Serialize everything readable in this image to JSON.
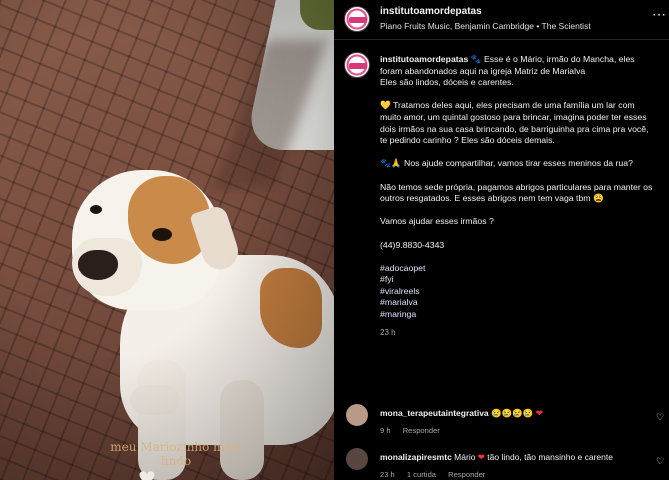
{
  "photo": {
    "caption_line1": "meu Mariozinho mais",
    "caption_line2": "lindo",
    "sticker_icon": "heart-sticker-icon"
  },
  "header": {
    "username": "institutoamordepatas",
    "audio": "Piano Fruits Music, Benjamin Cambridge • The Scientist",
    "more_icon": "more-dots-icon"
  },
  "caption": {
    "username": "institutoamordepatas",
    "line_intro": " 🐾 Esse é o Mário, irmão do Mancha, eles foram abandonados aqui na igreja Matriz de Marialva",
    "line_intro2": "Eles são lindos, dóceis e carentes.",
    "para2": "💛 Tratamos deles aqui, eles precisam de uma família um lar com muito amor, um quintal gostoso para brincar, imagina poder ter esses dois irmãos na sua casa brincando, de barriguinha pra cima pra você, te pedindo carinho ? Eles são dóceis demais.",
    "para3": "🐾🙏 Nos ajude compartilhar, vamos tirar esses meninos da rua?",
    "para4": "Não temos sede própria, pagamos abrigos particulares para manter os outros resgatados. E esses abrigos nem tem vaga tbm 😩",
    "para5": "Vamos ajudar esses irmãos ?",
    "phone": "(44)9.8830-4343",
    "hashtags": [
      "#adocaopet",
      "#fyi",
      "#viralreels",
      "#marialva",
      "#maringa"
    ],
    "time": "23 h"
  },
  "comments": [
    {
      "username": "mona_terapeutaintegrativa",
      "text": " 😢😢😢😢 ",
      "heart": "❤",
      "time": "9 h",
      "reply": "Responder",
      "likes": "",
      "avatar_color": "#b89a86"
    },
    {
      "username": "monalizapiresmtc",
      "text": " Mário ",
      "heart": "❤",
      "text_after": " tão lindo, tão mansinho e carente",
      "time": "23 h",
      "likes": "1 curtida",
      "reply": "Responder",
      "avatar_color": "#5a4640"
    }
  ],
  "colors": {
    "background": "#000000",
    "hashtag": "#d6e4ff",
    "muted": "#a8a8a8"
  }
}
